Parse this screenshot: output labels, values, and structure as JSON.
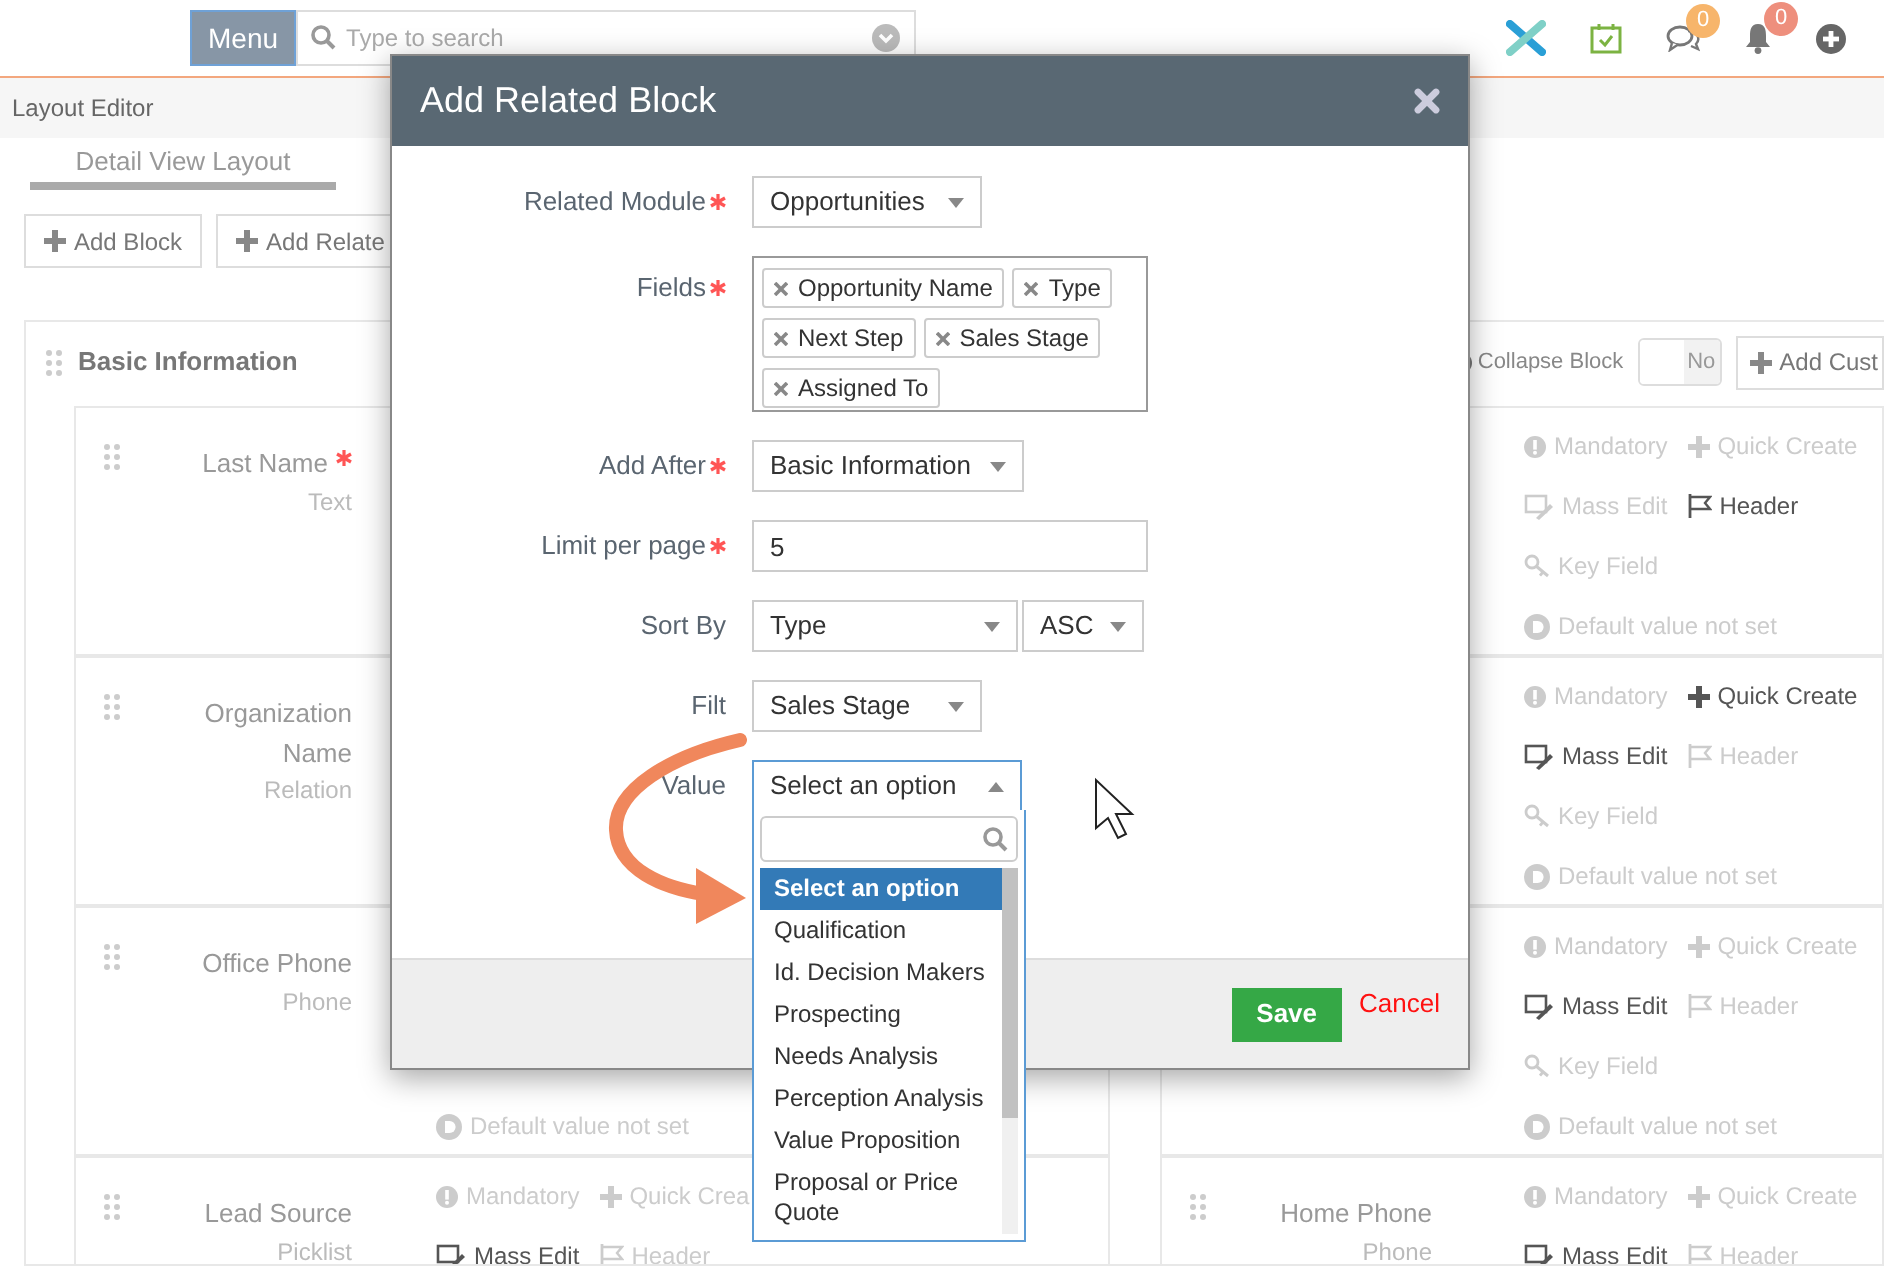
{
  "header": {
    "menu_button": "Menu",
    "search_placeholder": "Type to search",
    "icons": [
      {
        "kind": "logo"
      },
      {
        "kind": "calendar"
      },
      {
        "kind": "chat",
        "badge": "0",
        "color": "#f7b56b"
      },
      {
        "kind": "bell",
        "badge": "0",
        "color": "#ee8f7d"
      },
      {
        "kind": "add"
      }
    ]
  },
  "breadcrumb": "Layout Editor",
  "tabs": [
    {
      "label": "Detail View Layout",
      "selected": true
    }
  ],
  "toolbar": [
    "Add Block",
    "Add Relate"
  ],
  "block": {
    "title": "Basic Information",
    "collapse_label": "Collapse Block",
    "collapse_toggle": {
      "label": "No",
      "on": false
    },
    "add_button": "Add Cust",
    "rows": [
      {
        "left": {
          "name": "Last Name",
          "required": true,
          "type": "Text"
        },
        "right": {
          "properties": [
            {
              "kind": "mandatory",
              "label": "Mandatory",
              "active": false
            },
            {
              "kind": "quick_create",
              "label": "Quick Create",
              "active": false
            },
            {
              "kind": "mass_edit",
              "label": "Mass Edit",
              "active": false
            },
            {
              "kind": "header",
              "label": "Header",
              "active": true
            },
            {
              "kind": "key_field",
              "label": "Key Field",
              "active": false
            },
            {
              "kind": "default",
              "label": "Default value not set",
              "active": false
            }
          ]
        }
      },
      {
        "left": {
          "name": "Organization Name",
          "required": false,
          "type": "Relation"
        },
        "right": {
          "properties": [
            {
              "kind": "mandatory",
              "label": "Mandatory",
              "active": false
            },
            {
              "kind": "quick_create",
              "label": "Quick Create",
              "active": true
            },
            {
              "kind": "mass_edit",
              "label": "Mass Edit",
              "active": true
            },
            {
              "kind": "header",
              "label": "Header",
              "active": false
            },
            {
              "kind": "key_field",
              "label": "Key Field",
              "active": false
            },
            {
              "kind": "default",
              "label": "Default value not set",
              "active": false
            }
          ]
        }
      },
      {
        "left": {
          "name": "Office Phone",
          "required": false,
          "type": "Phone",
          "properties": [
            {
              "kind": "default",
              "label": "Default value not set",
              "active": false
            }
          ]
        },
        "right": {
          "properties": [
            {
              "kind": "mandatory",
              "label": "Mandatory",
              "active": false
            },
            {
              "kind": "quick_create",
              "label": "Quick Create",
              "active": false
            },
            {
              "kind": "mass_edit",
              "label": "Mass Edit",
              "active": true
            },
            {
              "kind": "header",
              "label": "Header",
              "active": false
            },
            {
              "kind": "key_field",
              "label": "Key Field",
              "active": false
            },
            {
              "kind": "default",
              "label": "Default value not set",
              "active": false
            }
          ]
        }
      },
      {
        "left": {
          "name": "Lead Source",
          "required": false,
          "type": "Picklist",
          "properties": [
            {
              "kind": "mandatory",
              "label": "Mandatory",
              "active": false
            },
            {
              "kind": "quick_create",
              "label": "Quick Crea",
              "active": false
            },
            {
              "kind": "mass_edit",
              "label": "Mass Edit",
              "active": true
            },
            {
              "kind": "header",
              "label": "Header",
              "active": false
            }
          ]
        },
        "right": {
          "name": "Home Phone",
          "required": false,
          "type": "Phone",
          "properties": [
            {
              "kind": "mandatory",
              "label": "Mandatory",
              "active": false
            },
            {
              "kind": "quick_create",
              "label": "Quick Create",
              "active": false
            },
            {
              "kind": "mass_edit",
              "label": "Mass Edit",
              "active": true
            },
            {
              "kind": "header",
              "label": "Header",
              "active": false
            }
          ]
        }
      }
    ]
  },
  "dialog": {
    "title": "Add Related Block",
    "fields": [
      {
        "kind": "select",
        "label": "Related Module",
        "required": true,
        "value": "Opportunities"
      },
      {
        "kind": "tags",
        "label": "Fields",
        "required": true,
        "tags": [
          "Opportunity Name",
          "Type",
          "Next Step",
          "Sales Stage",
          "Assigned To"
        ]
      },
      {
        "kind": "select",
        "label": "Add After",
        "required": true,
        "value": "Basic Information"
      },
      {
        "kind": "text",
        "label": "Limit per page",
        "required": true,
        "value": "5"
      },
      {
        "kind": "sort",
        "label": "Sort By",
        "required": false,
        "value": "Type",
        "order": "ASC"
      },
      {
        "kind": "select",
        "label": "Filt",
        "required": false,
        "value": "Sales Stage"
      },
      {
        "kind": "dropdown",
        "label": "Value",
        "required": false,
        "value": "Select an option",
        "expanded": true,
        "options": [
          {
            "label": "Select an option",
            "selected": true
          },
          {
            "label": "Qualification",
            "selected": false
          },
          {
            "label": "Id. Decision Makers",
            "selected": false
          },
          {
            "label": "Prospecting",
            "selected": false
          },
          {
            "label": "Needs Analysis",
            "selected": false
          },
          {
            "label": "Perception Analysis",
            "selected": false
          },
          {
            "label": "Value Proposition",
            "selected": false
          },
          {
            "label": "Proposal or Price Quote",
            "selected": false
          }
        ]
      }
    ],
    "save_button": "Save",
    "cancel_link": "Cancel"
  }
}
